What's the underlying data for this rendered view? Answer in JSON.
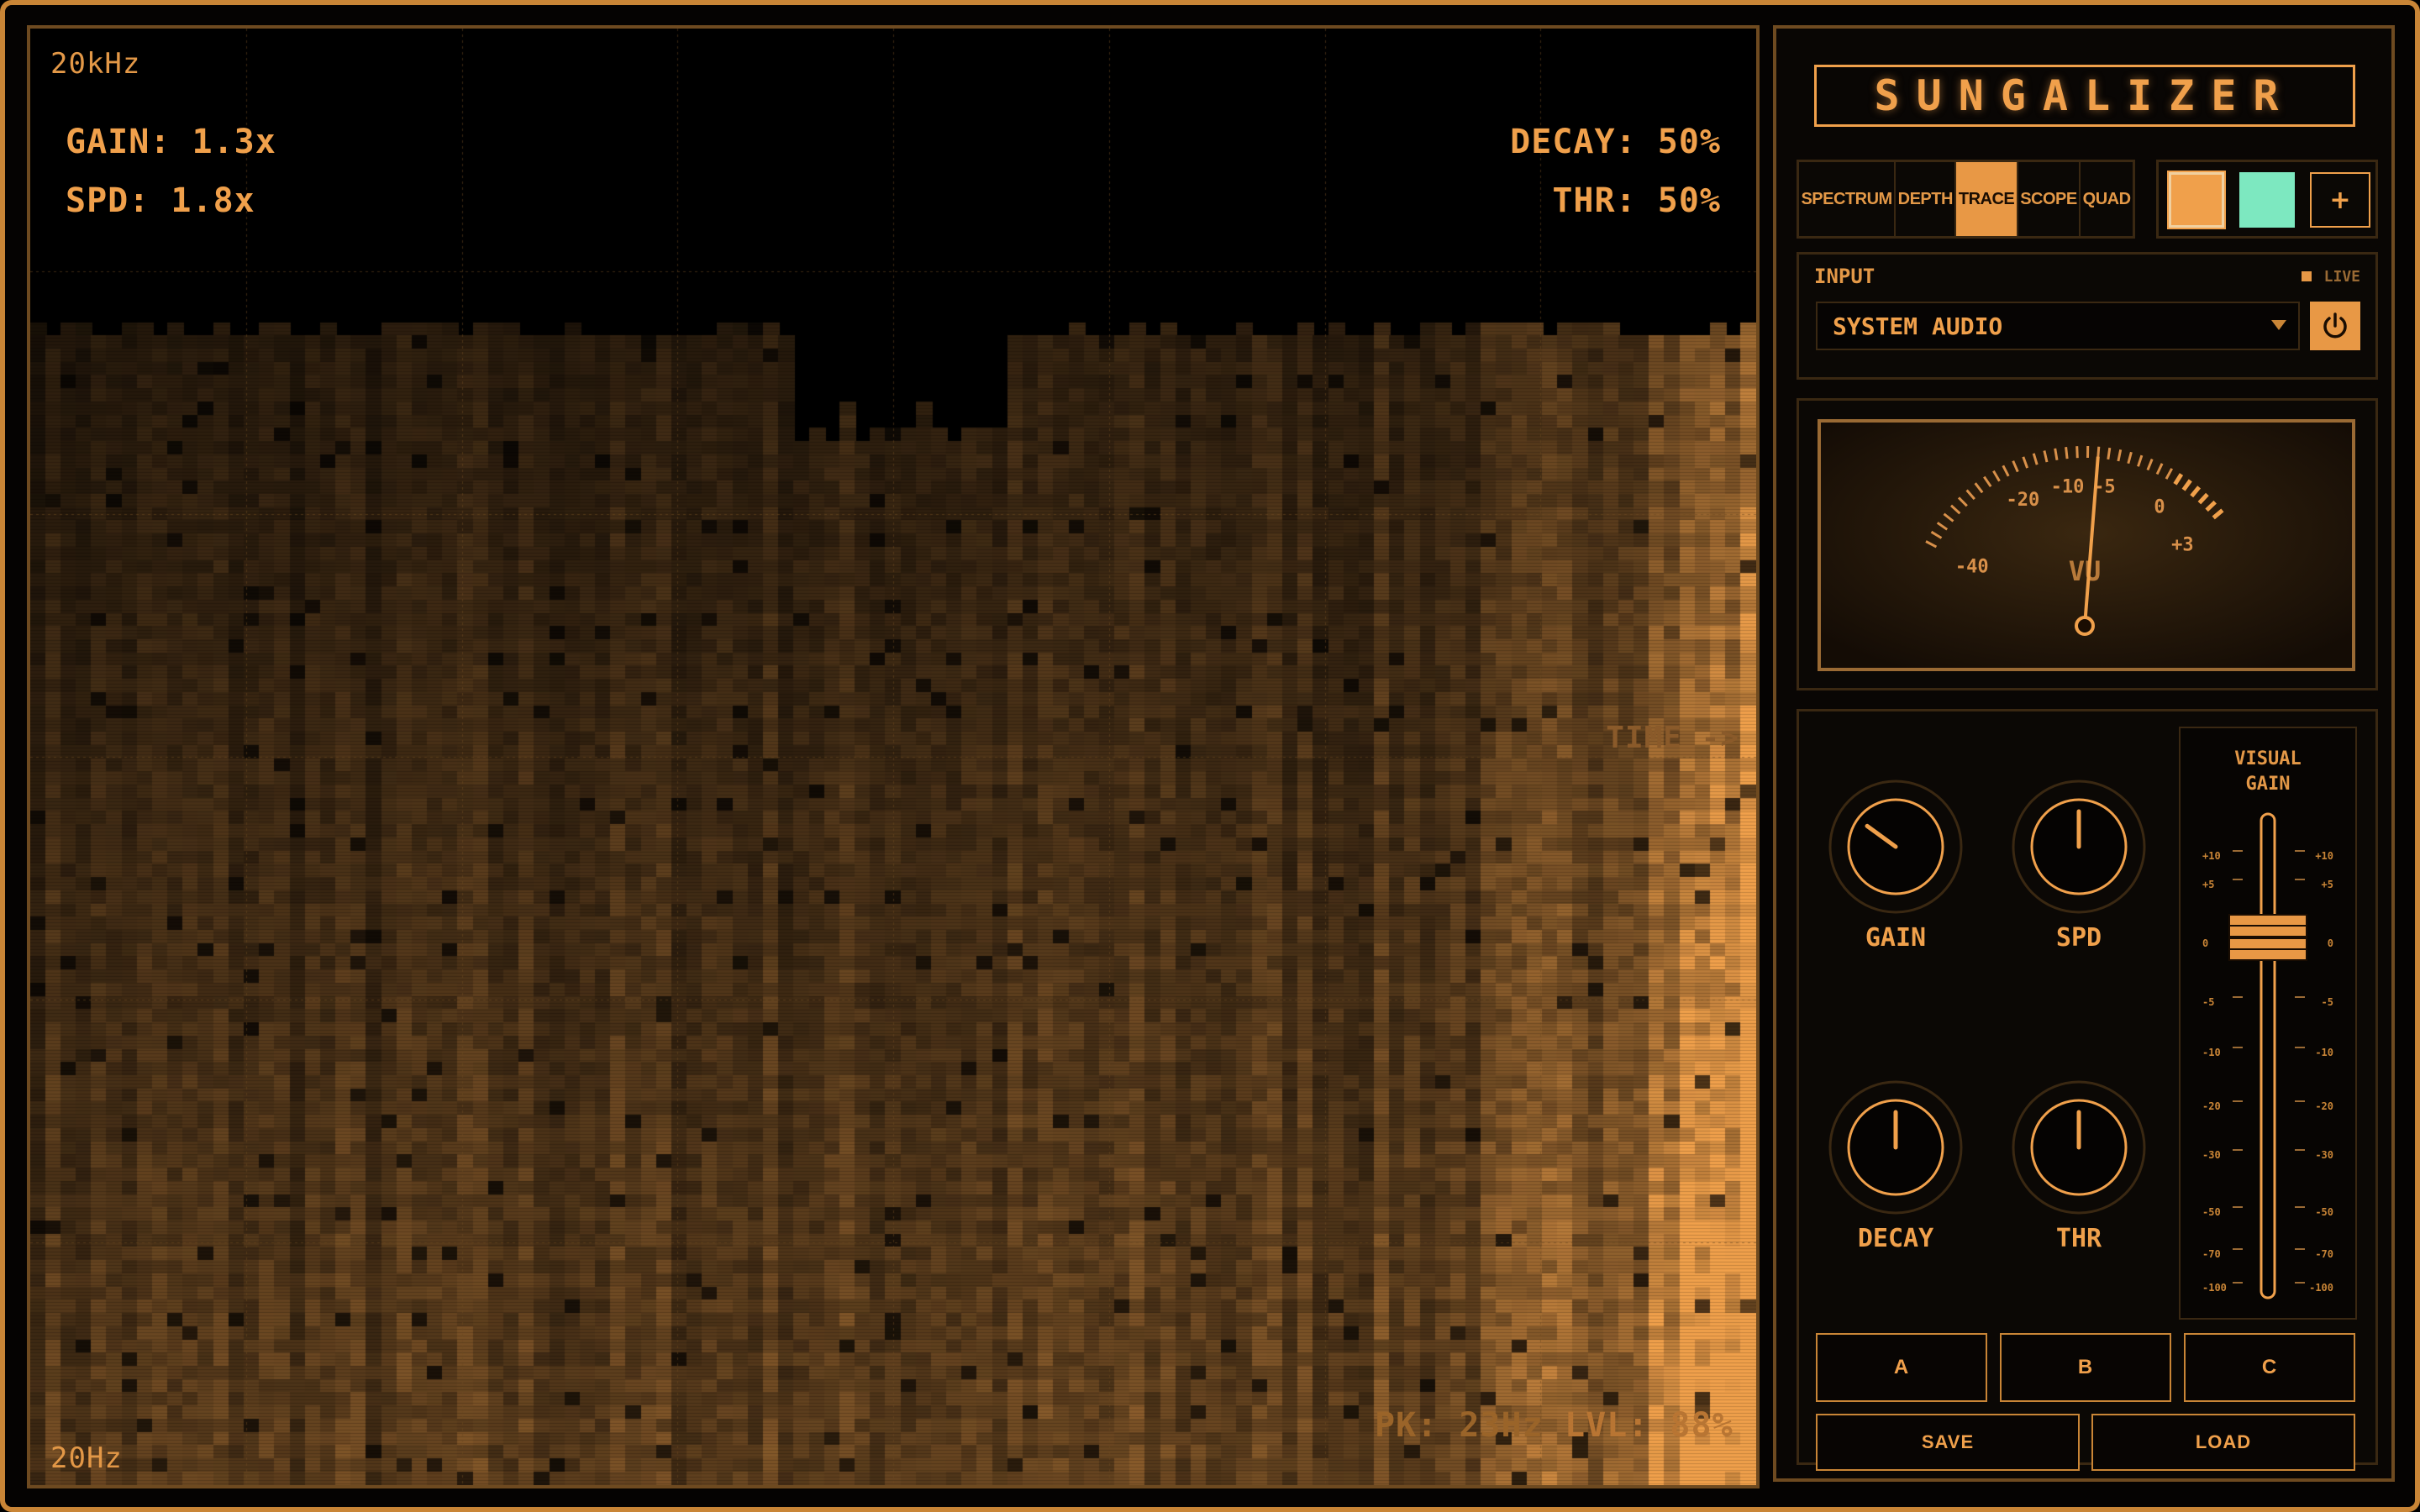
{
  "app": {
    "title": "SUNGALIZER",
    "accent_color": "#f0a04b",
    "secondary_color": "#7de8c0"
  },
  "display": {
    "freq_top": "20kHz",
    "freq_bottom": "20Hz",
    "gain_readout": "GAIN: 1.3x",
    "speed_readout": "SPD: 1.8x",
    "decay_readout": "DECAY: 50%",
    "threshold_readout": "THR: 50%",
    "time_label": "TIME ->",
    "peak_readout": "PK: 23Hz",
    "level_readout": "LVL: 88%"
  },
  "mode_tabs": [
    {
      "label": "SPECTRUM",
      "active": false
    },
    {
      "label": "DEPTH",
      "active": false
    },
    {
      "label": "TRACE",
      "active": true
    },
    {
      "label": "SCOPE",
      "active": false
    },
    {
      "label": "QUAD",
      "active": false
    }
  ],
  "color_swatches": {
    "primary": "#f0a04b",
    "secondary": "#7de8c0",
    "add_label": "+"
  },
  "input": {
    "label": "INPUT",
    "live_label": "LIVE",
    "selected_source": "SYSTEM AUDIO",
    "power_icon": "power-icon"
  },
  "vu_meter": {
    "label": "VU",
    "scale_labels": [
      "-40",
      "-20",
      "-10",
      "-5",
      "0",
      "+3"
    ],
    "needle_db": -6
  },
  "knobs": [
    {
      "label": "GAIN",
      "value": 0.3
    },
    {
      "label": "SPD",
      "value": 0.5
    },
    {
      "label": "DECAY",
      "value": 0.5
    },
    {
      "label": "THR",
      "value": 0.5
    }
  ],
  "visual_gain": {
    "title_line1": "VISUAL",
    "title_line2": "GAIN",
    "scale": [
      "+10",
      "+5",
      "0",
      "-5",
      "-10",
      "-20",
      "-30",
      "-50",
      "-70",
      "-100"
    ],
    "fader_value_db": 0
  },
  "presets": {
    "a": "A",
    "b": "B",
    "c": "C",
    "save": "SAVE",
    "load": "LOAD"
  }
}
